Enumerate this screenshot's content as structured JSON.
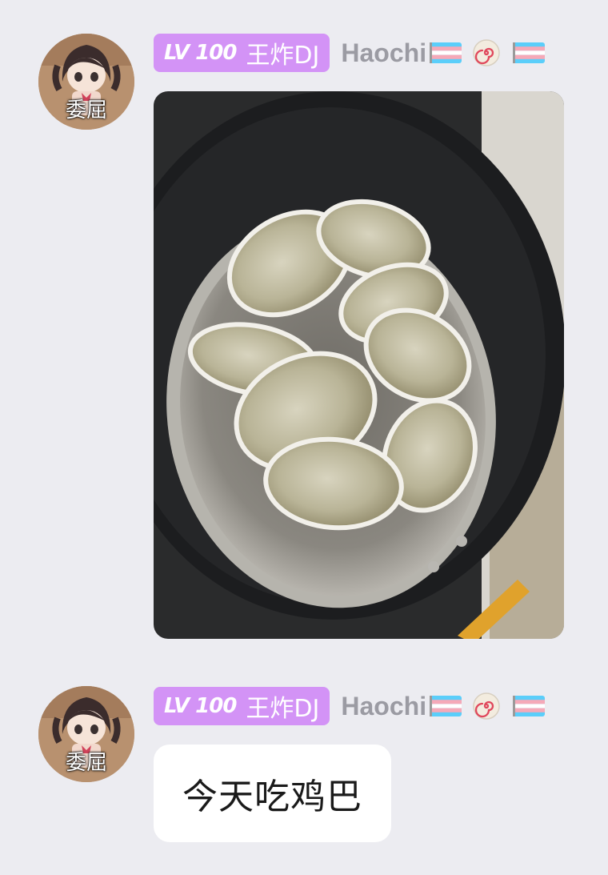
{
  "messages": [
    {
      "sender": {
        "avatar_label": "委屈",
        "level_badge": "LV 100",
        "title": "王炸DJ",
        "username": "Haochi",
        "badges": [
          "transgender-flag-icon",
          "naruto-fishcake-icon",
          "transgender-flag-icon"
        ]
      },
      "content_type": "image",
      "image_subject": "oyster-pan-photo"
    },
    {
      "sender": {
        "avatar_label": "委屈",
        "level_badge": "LV 100",
        "title": "王炸DJ",
        "username": "Haochi",
        "badges": [
          "transgender-flag-icon",
          "naruto-fishcake-icon",
          "transgender-flag-icon"
        ]
      },
      "content_type": "text",
      "text": "今天吃鸡巴"
    }
  ],
  "colors": {
    "background": "#ececf1",
    "badge": "#d393f6",
    "username": "#9b9ba3",
    "bubble": "#ffffff"
  }
}
